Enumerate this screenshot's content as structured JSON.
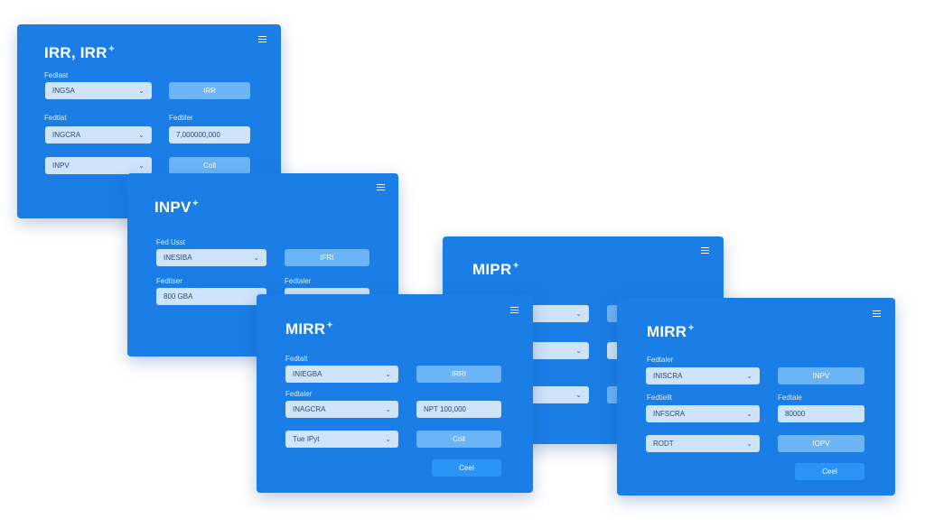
{
  "cards": {
    "irr": {
      "title": "IRR, IRR",
      "row1_label": "Fedlast",
      "row1_select": "INGSA",
      "row1_button": "IRR",
      "row2_label_left": "Fedtlat",
      "row2_label_right": "Fedtiler",
      "row2_select": "INGCRA",
      "row2_input": "7,000000,000",
      "row3_select": "INPV",
      "row3_button": "Coil"
    },
    "npv": {
      "title": "INPV",
      "row1_label": "Fed Usst",
      "row1_select": "INESIBA",
      "row1_button": "IFRI",
      "row2_label_left": "Fedtiser",
      "row2_label_right": "Fedtaler",
      "row2_select": "800 GBA"
    },
    "mirr_back": {
      "title": "MIPR"
    },
    "mirr_front_left": {
      "title": "MIRR",
      "row1_label": "Fedtalt",
      "row1_select": "INIEGBA",
      "row1_button": "IRRI",
      "row2_label": "Fedtaler",
      "row2_select": "INAGCRA",
      "row2_input": "NPT  100,000",
      "row3_select": "Tue IPyt",
      "row3_button": "Coil",
      "action_button": "Ceel"
    },
    "mirr_front_right": {
      "title": "MIRR",
      "row1_label": "Fedtaler",
      "row1_select": "INISCRA",
      "row1_button": "INPV",
      "row2_label_left": "Fedtiellt",
      "row2_label_right": "Fedtale",
      "row2_select": "INFSCRA",
      "row2_input": "80000",
      "row3_select": "RODT",
      "row3_button": "IOPV",
      "action_button": "Ceel"
    }
  },
  "colors": {
    "card": "#1b7ee6",
    "field": "#cfe3fb",
    "button": "#6bb5f6",
    "button_primary": "#2a95f7"
  },
  "icons": {
    "menu": "menu-icon",
    "chevron": "chevron-down-icon",
    "sparkle": "sparkle-icon"
  }
}
